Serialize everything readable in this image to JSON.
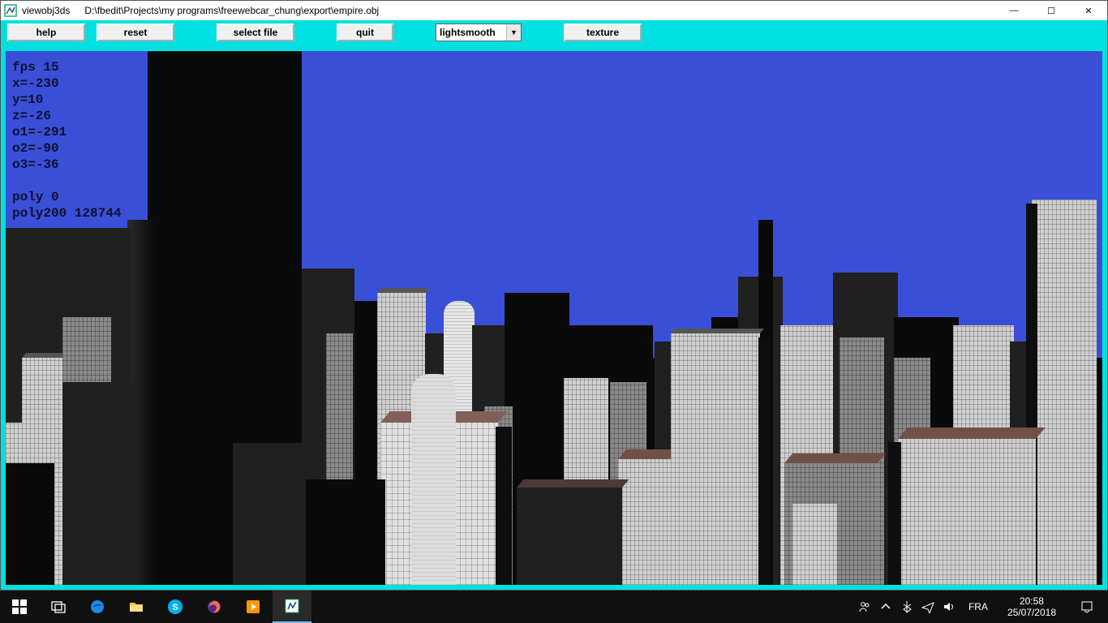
{
  "titlebar": {
    "app_name": "viewobj3ds",
    "file_path": "D:\\fbedit\\Projects\\my programs\\freewebcar_chung\\export\\empire.obj"
  },
  "toolbar": {
    "help_label": "help",
    "reset_label": "reset",
    "select_file_label": "select file",
    "quit_label": "quit",
    "dropdown_value": "lightsmooth",
    "texture_label": "texture"
  },
  "stats": {
    "fps_label": "fps",
    "fps_value": "15",
    "x_label": "x=",
    "x_value": "-230",
    "y_label": "y=",
    "y_value": "10",
    "z_label": "z=",
    "z_value": "-26",
    "o1_label": "o1=",
    "o1_value": "-291",
    "o2_label": "o2=",
    "o2_value": "-90",
    "o3_label": "o3=",
    "o3_value": "-36",
    "poly_label": "poly",
    "poly_value": "0",
    "poly200_label": "poly200",
    "poly200_value": "128744"
  },
  "win_controls": {
    "minimize": "—",
    "maximize": "☐",
    "close": "✕"
  },
  "taskbar": {
    "language": "FRA",
    "time": "20:58",
    "date": "25/07/2018"
  },
  "colors": {
    "accent_cyan": "#00e0e0",
    "sky_blue": "#3a4fd8",
    "overlay_text": "#101030"
  }
}
